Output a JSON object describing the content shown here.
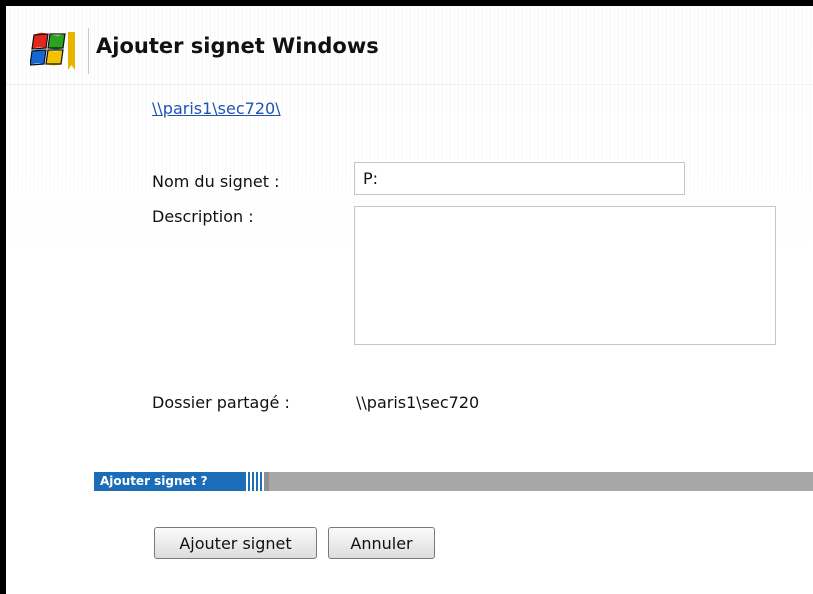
{
  "header": {
    "title": "Ajouter signet Windows",
    "icon": "windows-logo-icon"
  },
  "path_link": "\\\\paris1\\sec720\\",
  "form": {
    "name_label": "Nom du signet :",
    "name_value": "P:",
    "description_label": "Description :",
    "description_value": "",
    "shared_folder_label": "Dossier partagé :",
    "shared_folder_value": "\\\\paris1\\sec720"
  },
  "section": {
    "label": "Ajouter signet ?"
  },
  "buttons": {
    "add_label": "Ajouter signet",
    "cancel_label": "Annuler"
  },
  "colors": {
    "link": "#1f53b3",
    "section_accent": "#1b6db8",
    "section_bar": "#a7a7a7"
  }
}
